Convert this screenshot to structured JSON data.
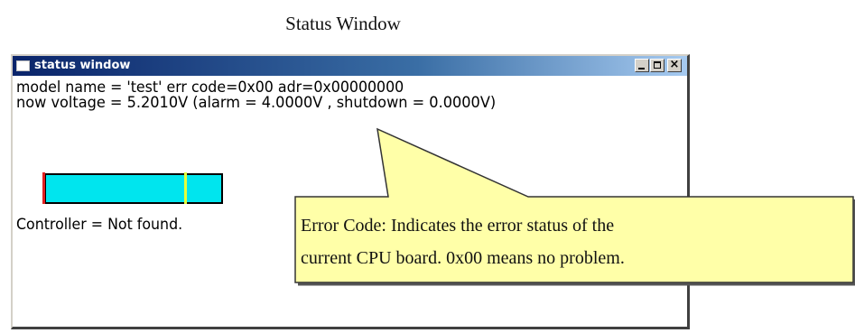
{
  "caption": "Status Window",
  "window": {
    "title": "status window",
    "controls": {
      "minimize": "_",
      "maximize": "□",
      "close": "×"
    }
  },
  "status": {
    "line1": "model name = 'test'  err code=0x00  adr=0x00000000",
    "line2": "now voltage = 5.2010V (alarm = 4.0000V , shutdown = 0.0000V)",
    "controller": "Controller = Not found."
  },
  "voltage_bar": {
    "fill_color": "#00e5ee",
    "alarm_marker_color": "#e6ff3a",
    "shutdown_marker_color": "#e02020"
  },
  "callout": {
    "line1": "Error Code: Indicates the error status of the",
    "line2": "current CPU board. 0x00 means no problem.",
    "fill": "#ffffa8"
  }
}
